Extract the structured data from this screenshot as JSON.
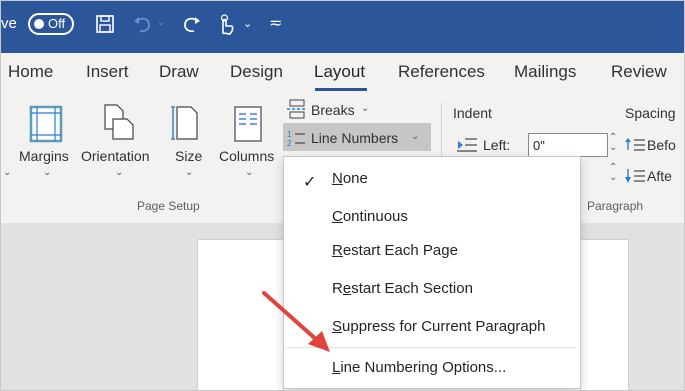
{
  "titlebar": {
    "autosave_fragment": "ve",
    "autosave_state": "Off"
  },
  "tabs": [
    {
      "label": "Home"
    },
    {
      "label": "Insert"
    },
    {
      "label": "Draw"
    },
    {
      "label": "Design"
    },
    {
      "label": "Layout"
    },
    {
      "label": "References"
    },
    {
      "label": "Mailings"
    },
    {
      "label": "Review"
    }
  ],
  "ribbon": {
    "page_setup": {
      "buttons": [
        {
          "label": "Margins"
        },
        {
          "label": "Orientation"
        },
        {
          "label": "Size"
        },
        {
          "label": "Columns"
        }
      ],
      "group_label": "Page Setup",
      "breaks_label": "Breaks",
      "line_numbers_label": "Line Numbers"
    },
    "paragraph": {
      "indent_label": "Indent",
      "left_label": "Left:",
      "left_value": "0\"",
      "spacing_label": "Spacing",
      "before_label": "Befo",
      "after_label": "Afte",
      "group_label": "Paragraph"
    }
  },
  "menu": {
    "items": [
      {
        "prefix": "",
        "ul": "N",
        "rest": "one",
        "checked": true
      },
      {
        "prefix": "",
        "ul": "C",
        "rest": "ontinuous",
        "checked": false
      },
      {
        "prefix": "",
        "ul": "R",
        "rest": "estart Each Page",
        "checked": false
      },
      {
        "prefix": "R",
        "ul": "e",
        "rest": "start Each Section",
        "checked": false
      },
      {
        "prefix": "",
        "ul": "S",
        "rest": "uppress for Current Paragraph",
        "checked": false
      },
      {
        "prefix": "",
        "ul": "L",
        "rest": "ine Numbering Options...",
        "checked": false
      }
    ]
  },
  "colors": {
    "title_bar": "#2b579a",
    "arrow": "#e0443a",
    "active_tab_underline": "#2b579a"
  }
}
